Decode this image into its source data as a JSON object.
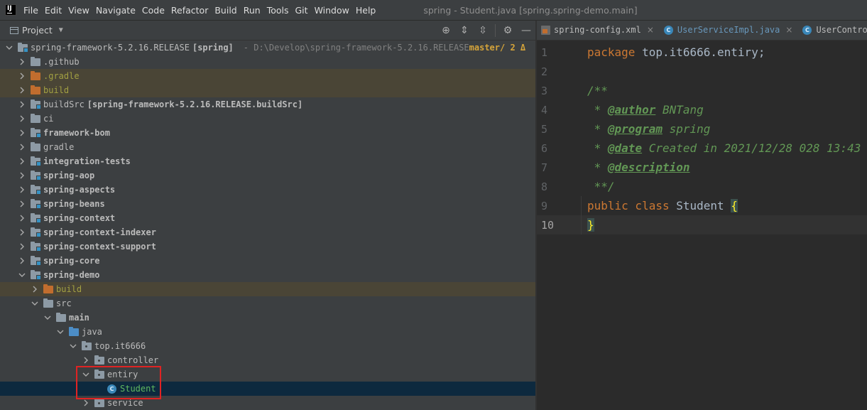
{
  "menu": {
    "items": [
      "File",
      "Edit",
      "View",
      "Navigate",
      "Code",
      "Refactor",
      "Build",
      "Run",
      "Tools",
      "Git",
      "Window",
      "Help"
    ],
    "title": "spring - Student.java [spring.spring-demo.main]"
  },
  "project": {
    "header": "Project",
    "tools": [
      "target-icon",
      "expand-all-icon",
      "collapse-all-icon",
      "gear-icon",
      "minimize-icon"
    ],
    "root": {
      "label": "spring-framework-5.2.16.RELEASE",
      "extra": "[spring]",
      "path": "- D:\\Develop\\spring-framework-5.2.16.RELEASE",
      "vcs": "master/ 2 Δ"
    },
    "items": [
      {
        "label": ".github",
        "style": "plain",
        "icon": "folder"
      },
      {
        "label": ".gradle",
        "style": "olive",
        "icon": "folder-orange"
      },
      {
        "label": "build",
        "style": "olive",
        "icon": "folder-orange"
      },
      {
        "label": "buildSrc",
        "extra": "[spring-framework-5.2.16.RELEASE.buildSrc]",
        "style": "plain",
        "icon": "folder-module"
      },
      {
        "label": "ci",
        "style": "plain",
        "icon": "folder"
      },
      {
        "label": "framework-bom",
        "style": "bold",
        "icon": "folder-module"
      },
      {
        "label": "gradle",
        "style": "plain",
        "icon": "folder"
      },
      {
        "label": "integration-tests",
        "style": "bold",
        "icon": "folder-module"
      },
      {
        "label": "spring-aop",
        "style": "bold",
        "icon": "folder-module"
      },
      {
        "label": "spring-aspects",
        "style": "bold",
        "icon": "folder-module"
      },
      {
        "label": "spring-beans",
        "style": "bold",
        "icon": "folder-module"
      },
      {
        "label": "spring-context",
        "style": "bold",
        "icon": "folder-module"
      },
      {
        "label": "spring-context-indexer",
        "style": "bold",
        "icon": "folder-module"
      },
      {
        "label": "spring-context-support",
        "style": "bold",
        "icon": "folder-module"
      },
      {
        "label": "spring-core",
        "style": "bold",
        "icon": "folder-module"
      },
      {
        "label": "spring-demo",
        "style": "bold",
        "icon": "folder-module"
      },
      {
        "label": "build",
        "style": "olive",
        "icon": "folder-orange"
      },
      {
        "label": "src",
        "style": "plain",
        "icon": "folder"
      },
      {
        "label": "main",
        "style": "bold",
        "icon": "folder"
      },
      {
        "label": "java",
        "style": "plain",
        "icon": "folder-blue"
      },
      {
        "label": "top.it6666",
        "style": "plain",
        "icon": "package"
      },
      {
        "label": "controller",
        "style": "plain",
        "icon": "package"
      },
      {
        "label": "entiry",
        "style": "plain",
        "icon": "package"
      },
      {
        "label": "Student",
        "style": "green",
        "icon": "class"
      },
      {
        "label": "service",
        "style": "plain",
        "icon": "package"
      }
    ]
  },
  "editor": {
    "tabs": [
      {
        "label": "spring-config.xml",
        "icon": "xml-file-icon"
      },
      {
        "label": "UserServiceImpl.java",
        "icon": "class-icon"
      },
      {
        "label": "UserControll",
        "icon": "class-icon"
      }
    ],
    "lines": [
      {
        "num": "1",
        "parts": [
          {
            "t": "package ",
            "c": "kw"
          },
          {
            "t": "top.it6666.entiry;",
            "c": "plain"
          }
        ]
      },
      {
        "num": "2",
        "parts": []
      },
      {
        "num": "3",
        "parts": [
          {
            "t": "/**",
            "c": "doc"
          }
        ]
      },
      {
        "num": "4",
        "parts": [
          {
            "t": " * ",
            "c": "doc"
          },
          {
            "t": "@author",
            "c": "tag"
          },
          {
            "t": " BNTang",
            "c": "doc"
          }
        ]
      },
      {
        "num": "5",
        "parts": [
          {
            "t": " * ",
            "c": "doc"
          },
          {
            "t": "@program",
            "c": "tag"
          },
          {
            "t": " spring",
            "c": "doc"
          }
        ]
      },
      {
        "num": "6",
        "parts": [
          {
            "t": " * ",
            "c": "doc"
          },
          {
            "t": "@date",
            "c": "tag"
          },
          {
            "t": " Created in 2021/12/28 028 13:43",
            "c": "doc"
          }
        ]
      },
      {
        "num": "7",
        "parts": [
          {
            "t": " * ",
            "c": "doc"
          },
          {
            "t": "@description",
            "c": "tag"
          }
        ]
      },
      {
        "num": "8",
        "parts": [
          {
            "t": " **/",
            "c": "doc"
          }
        ]
      },
      {
        "num": "9",
        "parts": [
          {
            "t": "public class ",
            "c": "kw"
          },
          {
            "t": "Student ",
            "c": "plain"
          },
          {
            "t": "{",
            "c": "brace-hl"
          }
        ]
      },
      {
        "num": "10",
        "parts": [
          {
            "t": "}",
            "c": "brace-hl"
          }
        ]
      }
    ],
    "current_line": "10"
  }
}
